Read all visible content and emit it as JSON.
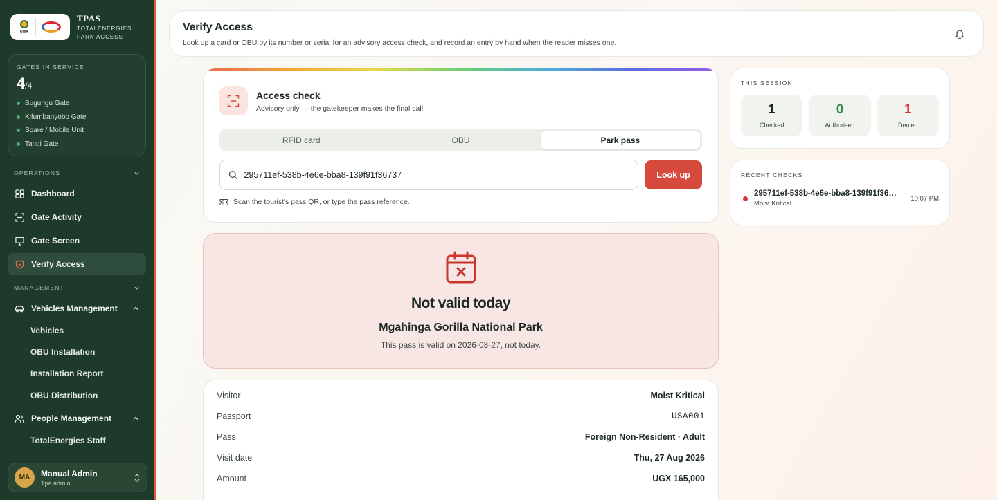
{
  "brand": {
    "title": "TPAS",
    "subtitle_line1": "TOTALENERGIES",
    "subtitle_line2": "PARK ACCESS",
    "uwa_text": "UWA"
  },
  "gates": {
    "label": "GATES IN SERVICE",
    "active": "4",
    "total": "/4",
    "list": [
      "Bugungu Gate",
      "Kifumbanyobo Gate",
      "Spare / Mobile Unit",
      "Tangi Gate"
    ]
  },
  "nav": {
    "operations_label": "OPERATIONS",
    "dashboard": "Dashboard",
    "gate_activity": "Gate Activity",
    "gate_screen": "Gate Screen",
    "verify_access": "Verify Access",
    "management_label": "MANAGEMENT",
    "vehicles_management": "Vehicles Management",
    "vehicles_sub": [
      "Vehicles",
      "OBU Installation",
      "Installation Report",
      "OBU Distribution"
    ],
    "people_management": "People Management",
    "people_sub": [
      "TotalEnergies Staff"
    ]
  },
  "user": {
    "initials": "MA",
    "name": "Manual Admin",
    "role": "Tpa admin"
  },
  "header": {
    "title": "Verify Access",
    "subtitle": "Look up a card or OBU by its number or serial for an advisory access check, and record an entry by hand when the reader misses one."
  },
  "access_check": {
    "title": "Access check",
    "subtitle": "Advisory only — the gatekeeper makes the final call.",
    "tabs": [
      "RFID card",
      "OBU",
      "Park pass"
    ],
    "active_tab": "Park pass",
    "search_value": "295711ef-538b-4e6e-bba8-139f91f36737",
    "lookup_label": "Look up",
    "hint": "Scan the tourist's pass QR, or type the pass reference."
  },
  "result": {
    "title": "Not valid today",
    "park": "Mgahinga Gorilla National Park",
    "message": "This pass is valid on 2026-08-27, not today."
  },
  "details": [
    {
      "key": "Visitor",
      "value": "Moist Kritical"
    },
    {
      "key": "Passport",
      "value": "USA001"
    },
    {
      "key": "Pass",
      "value": "Foreign Non-Resident · Adult"
    },
    {
      "key": "Visit date",
      "value": "Thu, 27 Aug 2026"
    },
    {
      "key": "Amount",
      "value": "UGX 165,000"
    }
  ],
  "session": {
    "label": "THIS SESSION",
    "checked": "1",
    "checked_label": "Checked",
    "authorised": "0",
    "authorised_label": "Authorised",
    "denied": "1",
    "denied_label": "Denied"
  },
  "recent": {
    "label": "RECENT CHECKS",
    "items": [
      {
        "id": "295711ef-538b-4e6e-bba8-139f91f36737",
        "name": "Moist Kritical",
        "time": "10:07 PM"
      }
    ]
  },
  "colors": {
    "sidebar": "#1d3a2a",
    "accent": "#d54a3d",
    "authorised": "#2f8a4f",
    "denied": "#d23a33",
    "gate_dot": "#4caf6f"
  },
  "icons": {
    "gates": "green-dot",
    "nav": [
      "grid-icon",
      "scan-icon",
      "monitor-icon",
      "shield-icon",
      "car-icon",
      "users-icon"
    ],
    "other": [
      "bell-icon",
      "scan-frame-icon",
      "search-icon",
      "ticket-icon",
      "calendar-x-icon",
      "chevron-down-icon",
      "chevron-up-icon",
      "selector-icon"
    ]
  }
}
